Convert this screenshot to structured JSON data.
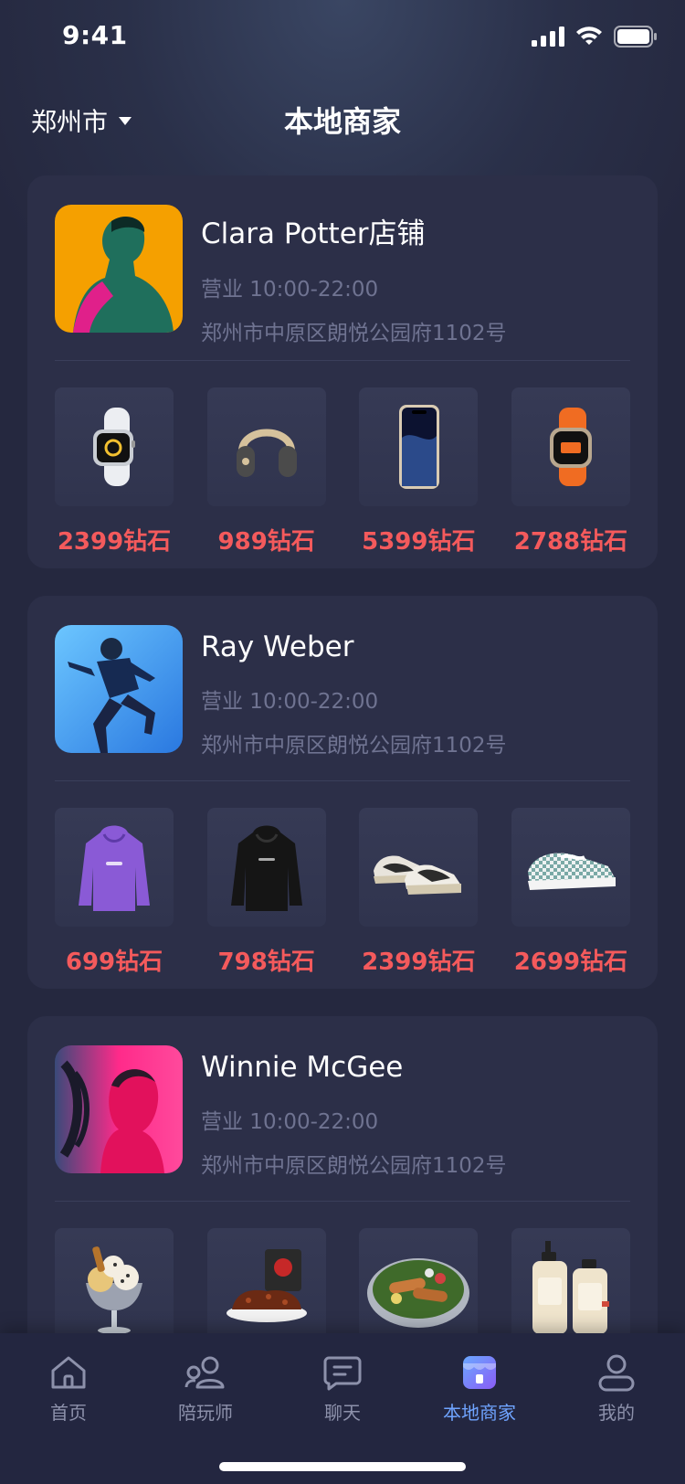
{
  "status": {
    "time": "9:41"
  },
  "header": {
    "city": "郑州市",
    "title": "本地商家"
  },
  "stores": [
    {
      "name": "Clara Potter店铺",
      "hours": "营业 10:00-22:00",
      "address": "郑州市中原区朗悦公园府1102号",
      "products": [
        {
          "price": "2399钻石",
          "icon": "smartwatch-white"
        },
        {
          "price": "989钻石",
          "icon": "headphones"
        },
        {
          "price": "5399钻石",
          "icon": "smartphone"
        },
        {
          "price": "2788钻石",
          "icon": "smartwatch-orange"
        }
      ]
    },
    {
      "name": "Ray Weber",
      "hours": "营业 10:00-22:00",
      "address": "郑州市中原区朗悦公园府1102号",
      "products": [
        {
          "price": "699钻石",
          "icon": "hoodie-purple"
        },
        {
          "price": "798钻石",
          "icon": "hoodie-black"
        },
        {
          "price": "2399钻石",
          "icon": "sneakers-nike"
        },
        {
          "price": "2699钻石",
          "icon": "sneaker-checkered"
        }
      ]
    },
    {
      "name": "Winnie McGee",
      "hours": "营业 10:00-22:00",
      "address": "郑州市中原区朗悦公园府1102号",
      "products": [
        {
          "price": "",
          "icon": "ice-cream-sundae"
        },
        {
          "price": "",
          "icon": "meat-plate"
        },
        {
          "price": "",
          "icon": "salad-bowl"
        },
        {
          "price": "",
          "icon": "lotion-bottles"
        }
      ]
    }
  ],
  "tabbar": {
    "items": [
      {
        "label": "首页",
        "icon": "home-icon"
      },
      {
        "label": "陪玩师",
        "icon": "user-group-icon"
      },
      {
        "label": "聊天",
        "icon": "chat-icon"
      },
      {
        "label": "本地商家",
        "icon": "store-icon",
        "active": true
      },
      {
        "label": "我的",
        "icon": "profile-icon"
      }
    ]
  },
  "colors": {
    "price": "#f45a5c",
    "active_tab": "#6fa4ff",
    "background": "#25283f",
    "card": "#2c2f48"
  }
}
